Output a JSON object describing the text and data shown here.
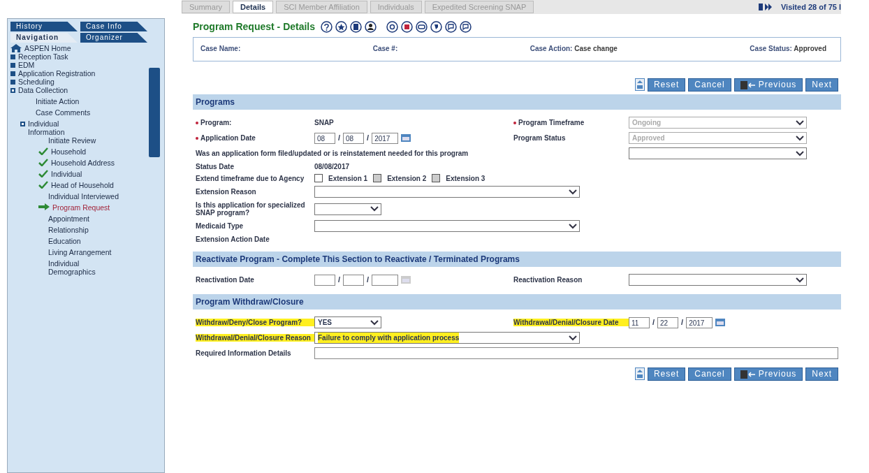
{
  "sidebar": {
    "tabs": [
      {
        "label": "History",
        "selected": false
      },
      {
        "label": "Case Info",
        "selected": false
      },
      {
        "label": "Navigation",
        "selected": true
      },
      {
        "label": "Organizer",
        "selected": false
      }
    ],
    "items": [
      {
        "label": "ASPEN Home",
        "kind": "home"
      },
      {
        "label": "Reception Task",
        "kind": "node"
      },
      {
        "label": "EDM",
        "kind": "node"
      },
      {
        "label": "Application Registration",
        "kind": "node"
      },
      {
        "label": "Scheduling",
        "kind": "node"
      },
      {
        "label": "Data Collection",
        "kind": "open",
        "children": [
          {
            "label": "Initiate Action",
            "kind": "leaf"
          },
          {
            "label": "Case Comments",
            "kind": "leaf"
          },
          {
            "label": "Individual Information",
            "kind": "open",
            "children": [
              {
                "label": "Initiate Review",
                "done": false,
                "current": false
              },
              {
                "label": "Household",
                "done": true,
                "current": false
              },
              {
                "label": "Household Address",
                "done": true,
                "current": false
              },
              {
                "label": "Individual",
                "done": true,
                "current": false
              },
              {
                "label": "Head of Household",
                "done": true,
                "current": false
              },
              {
                "label": "Individual Interviewed",
                "done": false,
                "current": false
              },
              {
                "label": "Program Request",
                "done": false,
                "current": true
              },
              {
                "label": "Appointment",
                "done": false,
                "current": false
              },
              {
                "label": "Relationship",
                "done": false,
                "current": false
              },
              {
                "label": "Education",
                "done": false,
                "current": false
              },
              {
                "label": "Living Arrangement",
                "done": false,
                "current": false
              },
              {
                "label": "Individual Demographics",
                "done": false,
                "current": false
              }
            ]
          }
        ]
      }
    ]
  },
  "tabs": [
    {
      "label": "Summary",
      "selected": false
    },
    {
      "label": "Details",
      "selected": true
    },
    {
      "label": "SCI Member Affiliation",
      "selected": false
    },
    {
      "label": "Individuals",
      "selected": false
    },
    {
      "label": "Expedited Screening SNAP",
      "selected": false
    }
  ],
  "visited": "Visited 28 of 75 I",
  "page_title": "Program Request - Details",
  "case_bar": [
    {
      "label": "Case Name:"
    },
    {
      "label": "Case #:"
    },
    {
      "label": "Case Action:",
      "value": "Case change"
    },
    {
      "label": "Case Status:",
      "value": "Approved"
    }
  ],
  "buttons_top": [
    "Reset",
    "Cancel",
    "Previous",
    "Next"
  ],
  "sections": [
    {
      "title": "Programs",
      "rows": [
        {
          "kind": "split",
          "fields": [
            {
              "label": "Program:",
              "required": true,
              "kind": "text",
              "value": "SNAP",
              "label_highlighted": false
            },
            {
              "label": "Program Timeframe",
              "required": true,
              "kind": "select",
              "value": "Ongoing",
              "disabled": true,
              "label_highlighted": false
            }
          ]
        },
        {
          "kind": "split",
          "fields": [
            {
              "label": "Application Date",
              "required": true,
              "kind": "date",
              "parts": [
                "08",
                "08",
                "2017"
              ],
              "separators": [
                "/",
                "/"
              ],
              "label_highlighted": false
            },
            {
              "label": "Program Status",
              "required": false,
              "kind": "select",
              "value": "Approved",
              "disabled": true,
              "label_highlighted": false
            }
          ]
        },
        {
          "kind": "long",
          "fields": [
            {
              "label": "Was an application form filed/updated or is reinstatement needed for this program",
              "required": false,
              "kind": "select",
              "disabled": false,
              "label_highlighted": false
            }
          ]
        },
        {
          "kind": "single",
          "fields": [
            {
              "label": "Status Date",
              "required": false,
              "kind": "text",
              "value": "08/08/2017",
              "label_highlighted": false
            }
          ]
        },
        {
          "kind": "single",
          "fields": [
            {
              "label": "Extend timeframe due to Agency",
              "required": false,
              "kind": "checks",
              "options": [
                {
                  "label": "Extension 1",
                  "checked": false,
                  "disabled": false
                },
                {
                  "label": "Extension 2",
                  "checked": false,
                  "disabled": true
                },
                {
                  "label": "Extension 3",
                  "checked": false,
                  "disabled": true
                }
              ],
              "label_highlighted": false
            }
          ]
        },
        {
          "kind": "single",
          "fields": [
            {
              "label": "Extension Reason",
              "required": false,
              "kind": "select",
              "disabled": false,
              "label_highlighted": false
            }
          ]
        },
        {
          "kind": "single",
          "fields": [
            {
              "label": "Is this application for specialized SNAP program?",
              "required": false,
              "kind": "shortselect",
              "disabled": false,
              "label_highlighted": false
            }
          ]
        },
        {
          "kind": "single",
          "fields": [
            {
              "label": "Medicaid Type",
              "required": false,
              "kind": "select",
              "disabled": false,
              "label_highlighted": false
            }
          ]
        },
        {
          "kind": "single",
          "fields": [
            {
              "label": "Extension Action Date",
              "required": false,
              "kind": "text",
              "label_highlighted": false
            }
          ]
        }
      ]
    },
    {
      "title": "Reactivate Program - Complete This Section to Reactivate / Terminated Programs",
      "rows": [
        {
          "kind": "split",
          "fields": [
            {
              "label": "Reactivation Date",
              "required": false,
              "kind": "date",
              "separators": [
                "/",
                "/"
              ],
              "label_highlighted": false
            },
            {
              "label": "Reactivation Reason",
              "required": false,
              "kind": "select",
              "disabled": false,
              "label_highlighted": false
            }
          ]
        }
      ]
    },
    {
      "title": "Program Withdraw/Closure",
      "rows": [
        {
          "kind": "split",
          "fields": [
            {
              "label": "Withdraw/Deny/Close Program?",
              "required": false,
              "kind": "shortselect",
              "value": "YES",
              "disabled": false,
              "label_highlighted": true,
              "value_highlighted": false
            },
            {
              "label": "Withdrawal/Denial/Closure Date",
              "required": false,
              "kind": "date",
              "parts": [
                "11",
                "22",
                "2017"
              ],
              "separators": [
                "/",
                "/"
              ],
              "label_highlighted": true
            }
          ]
        },
        {
          "kind": "single",
          "fields": [
            {
              "label": "Withdrawal/Denial/Closure Reason",
              "required": false,
              "kind": "select",
              "value": "Failure to comply with application process",
              "disabled": false,
              "label_highlighted": true,
              "value_highlighted": true
            }
          ]
        },
        {
          "kind": "single",
          "fields": [
            {
              "label": "Required Information Details",
              "required": false,
              "kind": "input",
              "label_highlighted": false
            }
          ]
        }
      ]
    }
  ],
  "buttons_bottom": [
    "Reset",
    "Cancel",
    "Previous",
    "Next"
  ]
}
